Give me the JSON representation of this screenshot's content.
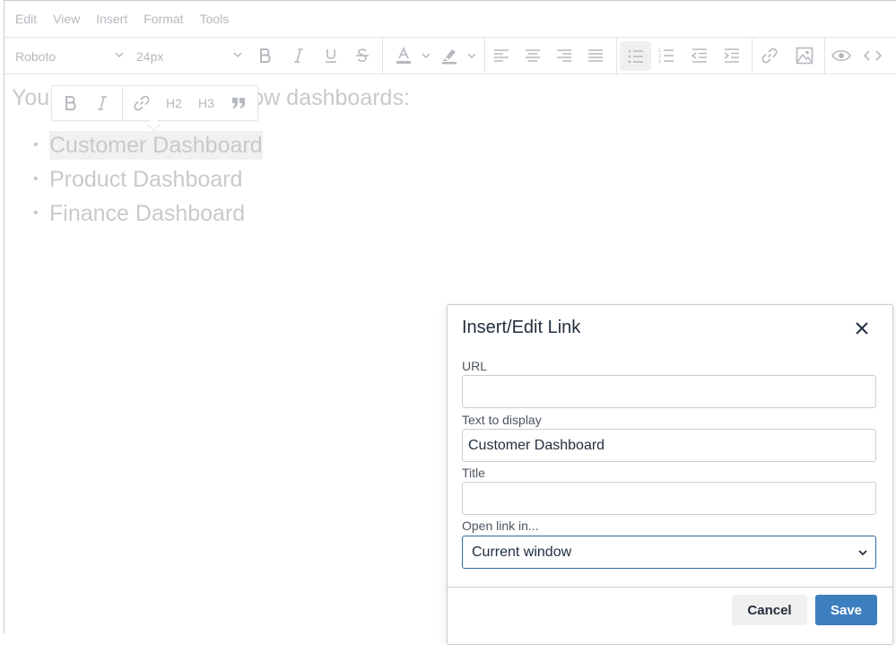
{
  "menubar": {
    "items": [
      "Edit",
      "View",
      "Insert",
      "Format",
      "Tools"
    ]
  },
  "toolbar": {
    "font_family": "Roboto",
    "font_size": "24px"
  },
  "content": {
    "paragraph_start": "You",
    "paragraph_end": "e below dashboards:",
    "list_items": [
      "Customer Dashboard",
      "Product Dashboard",
      "Finance Dashboard"
    ],
    "bullet": "•"
  },
  "context_toolbar": {
    "h2": "H2",
    "h3": "H3"
  },
  "dialog": {
    "title": "Insert/Edit Link",
    "url_label": "URL",
    "url_value": "",
    "text_label": "Text to display",
    "text_value": "Customer Dashboard",
    "title_label": "Title",
    "title_value": "",
    "target_label": "Open link in...",
    "target_value": "Current window",
    "cancel_label": "Cancel",
    "save_label": "Save"
  },
  "colors": {
    "accent": "#3d7ebf",
    "muted_text": "#b5b9be"
  }
}
